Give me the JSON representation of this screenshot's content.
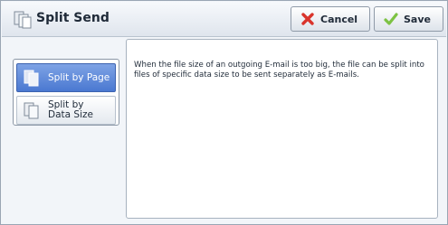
{
  "header": {
    "title": "Split Send",
    "title_icon": "split-send-icon",
    "cancel_label": "Cancel",
    "cancel_icon": "cancel-x-icon",
    "save_label": "Save",
    "save_icon": "checkmark-icon"
  },
  "options": {
    "split_by_page": {
      "label": "Split by Page",
      "icon": "page-split-icon",
      "selected": true
    },
    "split_by_data_size": {
      "label": "Split by\nData Size",
      "icon": "data-size-split-icon",
      "selected": false
    }
  },
  "description": {
    "text": "When the file size of an outgoing E-mail is too big, the file can be split into files of specific data size to be sent separately as E-mails."
  },
  "colors": {
    "selected_option": "#4a78d1",
    "cancel_icon": "#d9342b",
    "save_icon": "#7cc243"
  }
}
